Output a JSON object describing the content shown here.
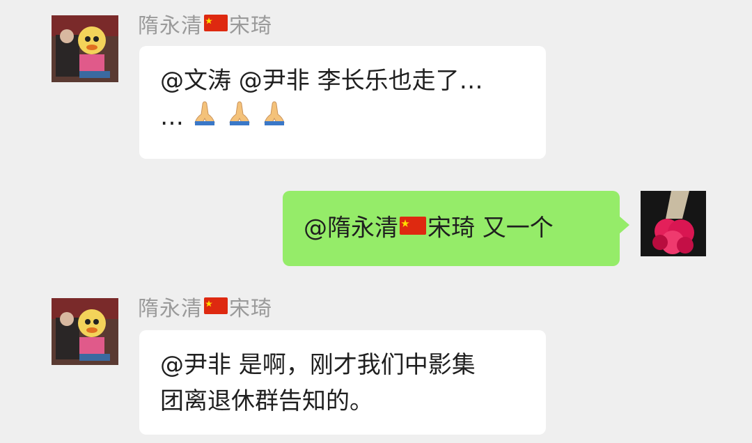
{
  "messages": [
    {
      "sender_name_part1": "隋永清",
      "sender_name_part2": "宋琦",
      "line1": "@文涛 @尹非 李长乐也走了…",
      "line2": "…",
      "emoji_icon": "folded-hands-icon"
    },
    {
      "mention": "@隋永清",
      "text": "宋琦 又一个"
    },
    {
      "sender_name_part1": "隋永清",
      "sender_name_part2": "宋琦",
      "line1": "@尹非 是啊，刚才我们中影集",
      "line2": "团离退休群告知的。"
    }
  ],
  "colors": {
    "background": "#efefef",
    "bubble_left": "#ffffff",
    "bubble_right": "#95ec69",
    "sender_name": "#9a9a9a",
    "flag_red": "#de2910",
    "flag_star": "#ffde00"
  }
}
